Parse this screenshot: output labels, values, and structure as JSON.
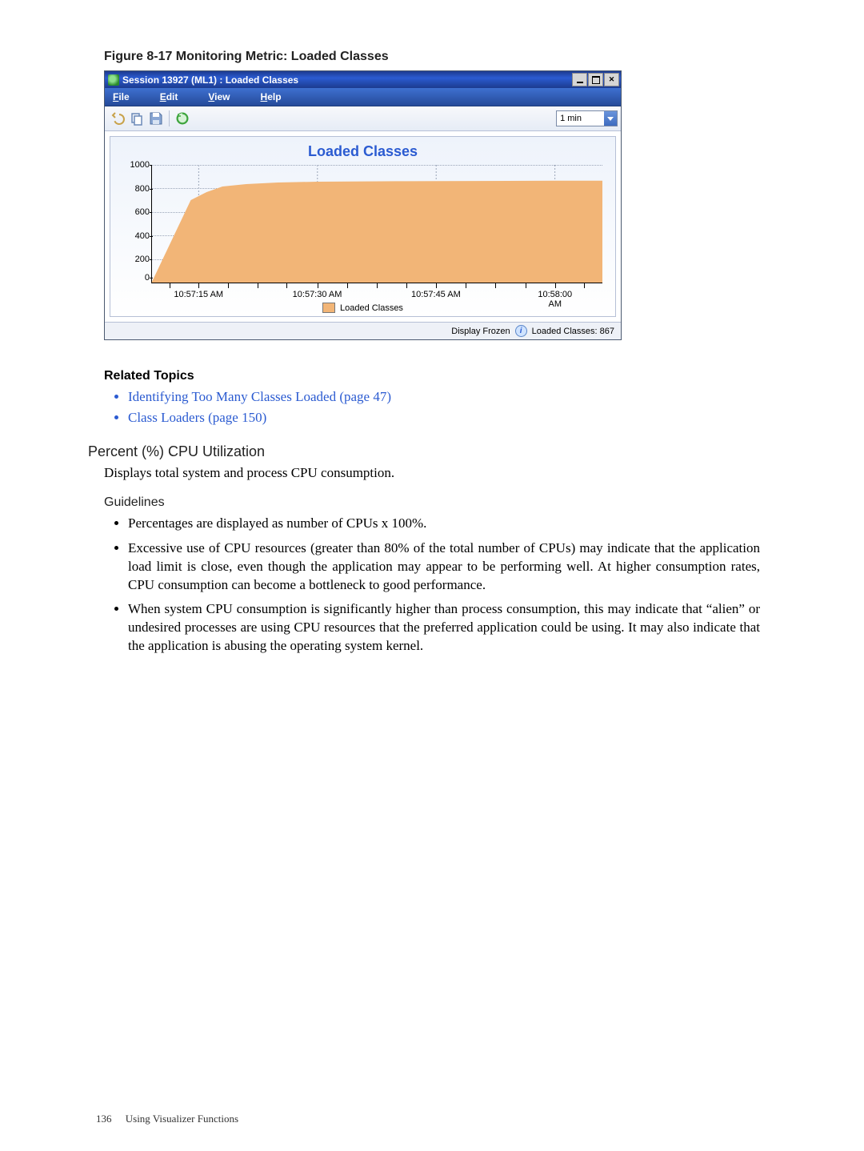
{
  "figure_caption": "Figure 8-17 Monitoring Metric: Loaded Classes",
  "window": {
    "title": "Session 13927 (ML1) : Loaded Classes",
    "menu": {
      "file": "File",
      "edit": "Edit",
      "view": "View",
      "help": "Help"
    },
    "interval_selected": "1 min"
  },
  "status": {
    "frozen": "Display Frozen",
    "loaded_classes_label": "Loaded Classes: 867"
  },
  "chart_data": {
    "type": "area",
    "title": "Loaded Classes",
    "ylabel": "",
    "xlabel": "",
    "ylim": [
      0,
      1000
    ],
    "yticks": [
      0,
      200,
      400,
      600,
      800,
      1000
    ],
    "xticks": [
      "10:57:15 AM",
      "10:57:30 AM",
      "10:57:45 AM",
      "10:58:00 AM"
    ],
    "series": [
      {
        "name": "Loaded Classes",
        "x": [
          "10:57:09",
          "10:57:14",
          "10:57:16",
          "10:57:18",
          "10:57:21",
          "10:57:25",
          "10:57:30",
          "10:57:40",
          "10:57:50",
          "10:58:00",
          "10:58:06"
        ],
        "values": [
          0,
          700,
          770,
          820,
          840,
          855,
          860,
          862,
          864,
          866,
          867
        ]
      }
    ],
    "legend_label": "Loaded Classes"
  },
  "related_topics": {
    "heading": "Related Topics",
    "items": [
      "Identifying Too Many Classes Loaded (page 47)",
      "Class Loaders (page 150)"
    ]
  },
  "section": {
    "heading": "Percent (%) CPU Utilization",
    "body": "Displays total system and process CPU consumption."
  },
  "guidelines": {
    "heading": "Guidelines",
    "items": [
      "Percentages are displayed as number of CPUs x 100%.",
      "Excessive use of CPU resources (greater than 80% of the total number of CPUs) may indicate that the application load limit is close, even though the application may appear to be performing well. At higher consumption rates, CPU consumption can become a bottleneck to good performance.",
      "When system CPU consumption is significantly higher than process consumption, this may indicate that “alien” or undesired processes are using CPU resources that the preferred application could be using. It may also indicate that the application is abusing the operating system kernel."
    ]
  },
  "footer": {
    "page_number": "136",
    "running_head": "Using Visualizer Functions"
  }
}
